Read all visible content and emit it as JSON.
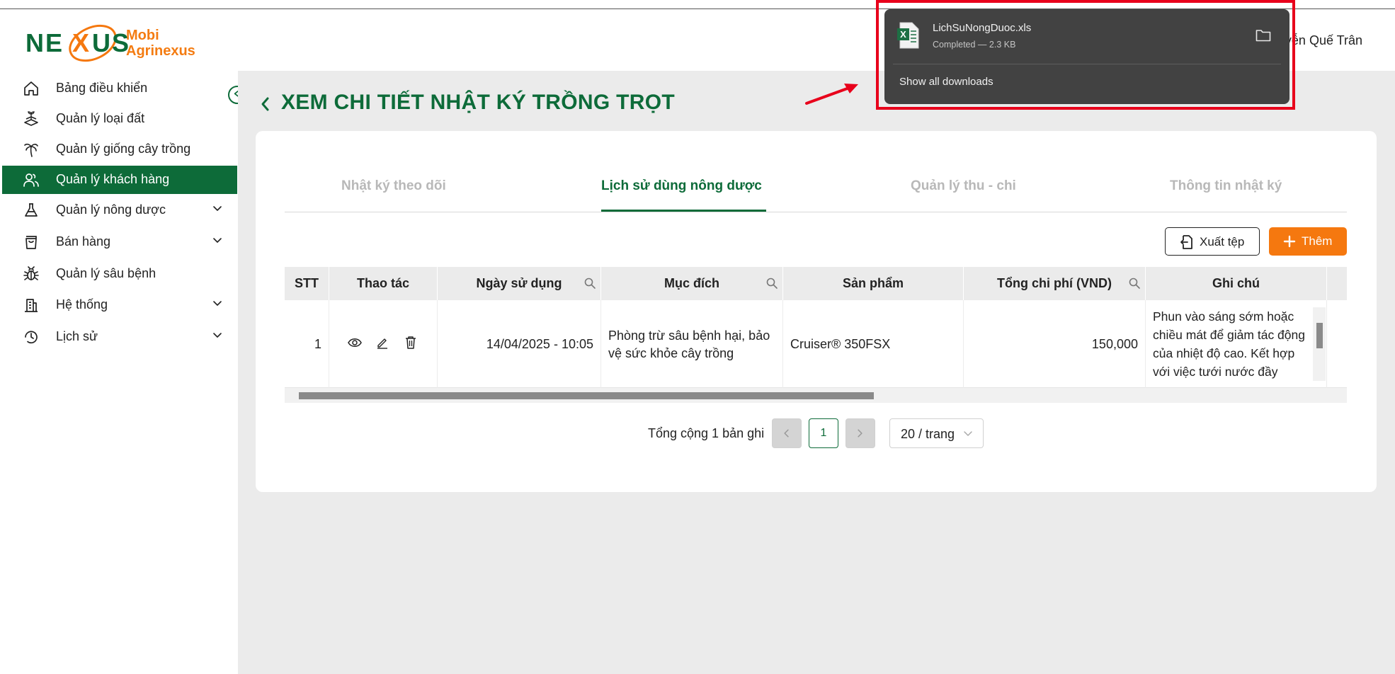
{
  "app": {
    "logo_alt": "NEXUS",
    "logo_line1": "Mobi",
    "logo_line2": "Agrinexus",
    "user_name": "yễn Quế Trân"
  },
  "sidebar": {
    "items": [
      {
        "label": "Bảng điều khiển",
        "icon": "home-icon",
        "active": false,
        "has_submenu": false
      },
      {
        "label": "Quản lý loại đất",
        "icon": "land-icon",
        "active": false,
        "has_submenu": false
      },
      {
        "label": "Quản lý giống cây trồng",
        "icon": "palm-tree-icon",
        "active": false,
        "has_submenu": false
      },
      {
        "label": "Quản lý khách hàng",
        "icon": "users-icon",
        "active": true,
        "has_submenu": false
      },
      {
        "label": "Quản lý nông dược",
        "icon": "flask-icon",
        "active": false,
        "has_submenu": true
      },
      {
        "label": "Bán hàng",
        "icon": "shopping-bag-icon",
        "active": false,
        "has_submenu": true
      },
      {
        "label": "Quản lý sâu bệnh",
        "icon": "bug-icon",
        "active": false,
        "has_submenu": false
      },
      {
        "label": "Hệ thống",
        "icon": "building-icon",
        "active": false,
        "has_submenu": true
      },
      {
        "label": "Lịch sử",
        "icon": "clock-icon",
        "active": false,
        "has_submenu": true
      }
    ]
  },
  "page": {
    "title": "XEM CHI TIẾT NHẬT KÝ TRỒNG TRỌT",
    "tabs": [
      {
        "label": "Nhật ký theo dõi",
        "active": false
      },
      {
        "label": "Lịch sử dùng nông dược",
        "active": true
      },
      {
        "label": "Quản lý thu - chi",
        "active": false
      },
      {
        "label": "Thông tin nhật ký",
        "active": false
      }
    ],
    "export_label": "Xuất tệp",
    "add_label": "Thêm"
  },
  "table": {
    "columns": [
      "STT",
      "Thao tác",
      "Ngày sử dụng",
      "Mục đích",
      "Sản phẩm",
      "Tổng chi phí (VND)",
      "Ghi chú"
    ],
    "searchable_columns": [
      "Ngày sử dụng",
      "Mục đích",
      "Tổng chi phí (VND)"
    ],
    "rows": [
      {
        "stt": "1",
        "date": "14/04/2025 - 10:05",
        "purpose": "Phòng trừ sâu bệnh hại, bảo vệ sức khỏe cây trồng",
        "product": "Cruiser® 350FSX",
        "cost": "150,000",
        "note": "Phun vào sáng sớm hoặc chiều mát để giảm tác động của nhiệt độ cao. Kết hợp với việc tưới nước đầy"
      }
    ]
  },
  "pagination": {
    "total_text": "Tổng cộng 1 bản ghi",
    "current_page": "1",
    "page_size": "20 / trang"
  },
  "download": {
    "file_name": "LichSuNongDuoc.xls",
    "status": "Completed — 2.3 KB",
    "show_all": "Show all downloads"
  },
  "colors": {
    "brand_green": "#0d6b39",
    "accent_orange": "#f5780f",
    "highlight_red": "#e8001b",
    "popup_bg": "#424242"
  }
}
